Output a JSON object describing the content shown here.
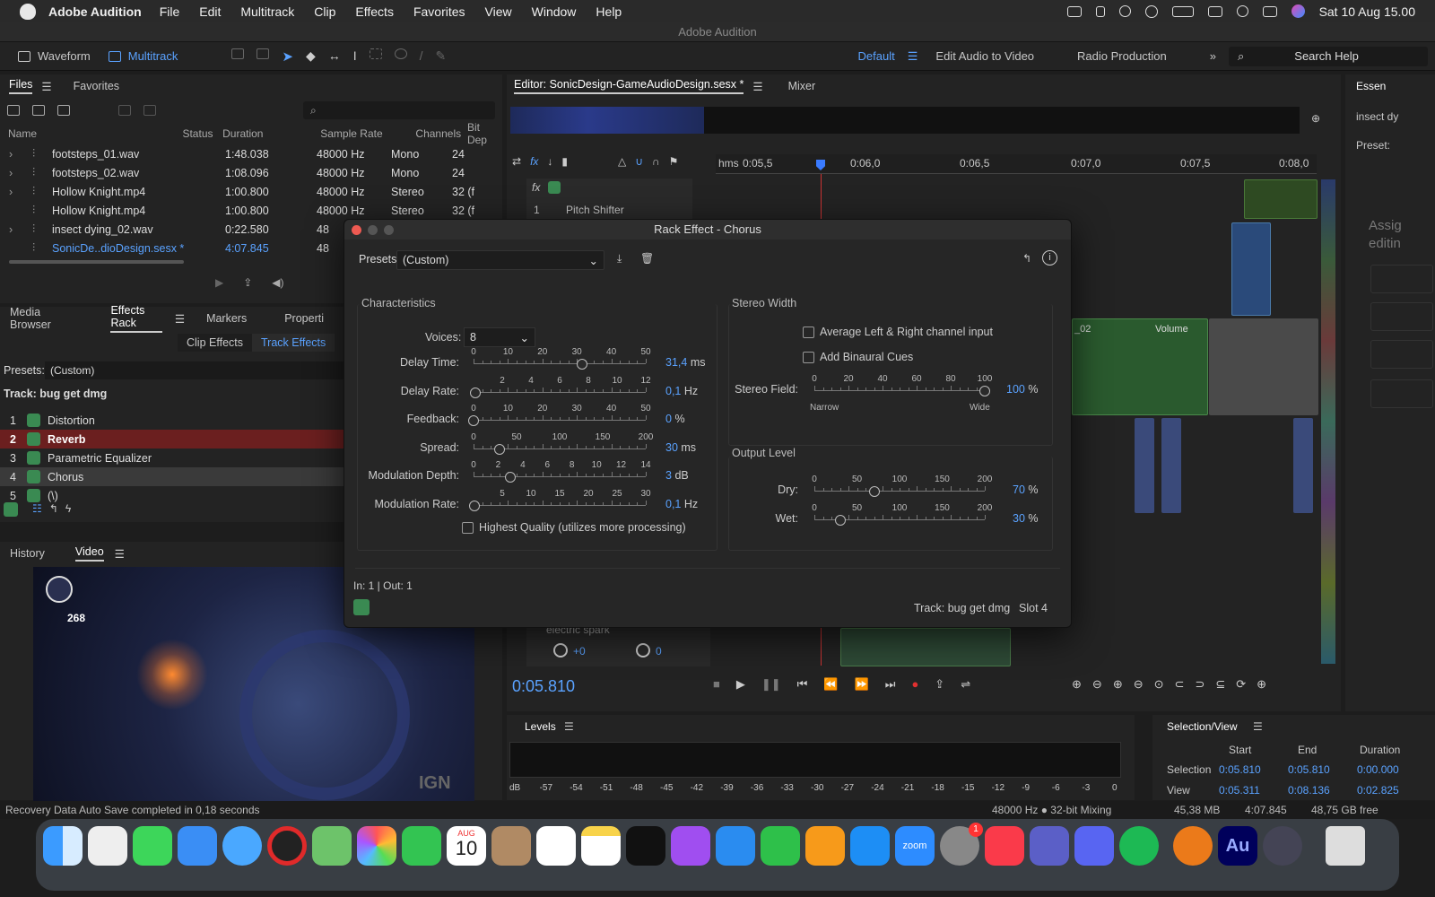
{
  "menubar": {
    "app": "Adobe Audition",
    "items": [
      "File",
      "Edit",
      "Multitrack",
      "Clip",
      "Effects",
      "Favorites",
      "View",
      "Window",
      "Help"
    ],
    "datetime": "Sat 10 Aug  15.00"
  },
  "window_title": "Adobe Audition",
  "toolbar": {
    "waveform": "Waveform",
    "multitrack": "Multitrack",
    "workspaces": [
      "Default",
      "Edit Audio to Video",
      "Radio Production"
    ],
    "search_placeholder": "Search Help"
  },
  "files_panel": {
    "tabs": [
      "Files",
      "Favorites"
    ],
    "columns": [
      "Name",
      "Status",
      "Duration",
      "Sample Rate",
      "Channels",
      "Bit Dep"
    ],
    "rows": [
      {
        "name": "footsteps_01.wav",
        "duration": "1:48.038",
        "rate": "48000 Hz",
        "channels": "Mono",
        "bits": "24"
      },
      {
        "name": "footsteps_02.wav",
        "duration": "1:08.096",
        "rate": "48000 Hz",
        "channels": "Mono",
        "bits": "24"
      },
      {
        "name": "Hollow Knight.mp4",
        "duration": "1:00.800",
        "rate": "48000 Hz",
        "channels": "Stereo",
        "bits": "32 (f"
      },
      {
        "name": "Hollow Knight.mp4",
        "duration": "1:00.800",
        "rate": "48000 Hz",
        "channels": "Stereo",
        "bits": "32 (f"
      },
      {
        "name": "insect dying_02.wav",
        "duration": "0:22.580",
        "rate": "48",
        "channels": "",
        "bits": ""
      },
      {
        "name": "SonicDe..dioDesign.sesx *",
        "duration": "4:07.845",
        "rate": "48",
        "channels": "",
        "bits": ""
      }
    ]
  },
  "effects_panel": {
    "tabs": [
      "Media Browser",
      "Effects Rack",
      "Markers",
      "Properti"
    ],
    "subtabs": [
      "Clip Effects",
      "Track Effects"
    ],
    "presets_label": "Presets:",
    "presets_value": "(Custom)",
    "track_label": "Track: bug get dmg",
    "items": [
      {
        "num": "1",
        "name": "Distortion"
      },
      {
        "num": "2",
        "name": "Reverb"
      },
      {
        "num": "3",
        "name": "Parametric Equalizer"
      },
      {
        "num": "4",
        "name": "Chorus"
      },
      {
        "num": "5",
        "name": "(\\)"
      }
    ]
  },
  "video_panel": {
    "tabs": [
      "History",
      "Video"
    ],
    "hud_count": "268",
    "watermark": "IGN"
  },
  "editor": {
    "tabs": [
      "Editor: SonicDesign-GameAudioDesign.sesx *",
      "Mixer"
    ],
    "ruler_labels": [
      "hms",
      "0:05,5",
      "0:06,0",
      "0:06,5",
      "0:07,0",
      "0:07,5",
      "0:08,0"
    ],
    "track_fx": "Pitch Shifter",
    "track_fx_num": "1",
    "clip_label": "_02",
    "volume_label": "Volume",
    "bottom_track": "electric spark",
    "knob_vol": "+0",
    "knob_pan": "0",
    "time": "0:05.810"
  },
  "right_panel": {
    "tab": "Essen",
    "item": "insect dy",
    "presets": "Preset:",
    "assign": "Assig",
    "editing": "editin"
  },
  "dialog": {
    "title": "Rack Effect - Chorus",
    "presets_label": "Presets:",
    "presets_value": "(Custom)",
    "characteristics": "Characteristics",
    "voices_label": "Voices:",
    "voices_value": "8",
    "sliders": [
      {
        "label": "Delay Time:",
        "ticks": [
          "0",
          "10",
          "20",
          "30",
          "40",
          "50"
        ],
        "min": 0,
        "max": 50,
        "value": 31.4,
        "display": "31,4",
        "unit": "ms"
      },
      {
        "label": "Delay Rate:",
        "ticks": [
          "2",
          "4",
          "6",
          "8",
          "10",
          "12"
        ],
        "min": 0,
        "max": 12,
        "value": 0.1,
        "display": "0,1",
        "unit": "Hz"
      },
      {
        "label": "Feedback:",
        "ticks": [
          "0",
          "10",
          "20",
          "30",
          "40",
          "50"
        ],
        "min": 0,
        "max": 50,
        "value": 0,
        "display": "0",
        "unit": "%"
      },
      {
        "label": "Spread:",
        "ticks": [
          "0",
          "50",
          "100",
          "150",
          "200"
        ],
        "min": 0,
        "max": 200,
        "value": 30,
        "display": "30",
        "unit": "ms"
      },
      {
        "label": "Modulation Depth:",
        "ticks": [
          "0",
          "2",
          "4",
          "6",
          "8",
          "10",
          "12",
          "14"
        ],
        "min": 0,
        "max": 14,
        "value": 3,
        "display": "3",
        "unit": "dB"
      },
      {
        "label": "Modulation Rate:",
        "ticks": [
          "5",
          "10",
          "15",
          "20",
          "25",
          "30"
        ],
        "min": 0,
        "max": 30,
        "value": 0.1,
        "display": "0,1",
        "unit": "Hz"
      }
    ],
    "highest_quality": "Highest Quality (utilizes more processing)",
    "stereo_width": "Stereo Width",
    "avg_lr": "Average Left & Right channel input",
    "binaural": "Add Binaural Cues",
    "stereo_field": {
      "label": "Stereo Field:",
      "ticks": [
        "0",
        "20",
        "40",
        "60",
        "80",
        "100"
      ],
      "min": 0,
      "max": 100,
      "value": 100,
      "display": "100",
      "unit": "%",
      "narrow": "Narrow",
      "wide": "Wide"
    },
    "output_level": "Output Level",
    "dry": {
      "label": "Dry:",
      "ticks": [
        "0",
        "50",
        "100",
        "150",
        "200"
      ],
      "min": 0,
      "max": 200,
      "value": 70,
      "display": "70",
      "unit": "%"
    },
    "wet": {
      "label": "Wet:",
      "ticks": [
        "0",
        "50",
        "100",
        "150",
        "200"
      ],
      "min": 0,
      "max": 200,
      "value": 30,
      "display": "30",
      "unit": "%"
    },
    "io": "In: 1 | Out: 1",
    "track": "Track: bug get dmg",
    "slot": "Slot 4"
  },
  "levels": {
    "title": "Levels",
    "scale": [
      "dB",
      "-57",
      "-54",
      "-51",
      "-48",
      "-45",
      "-42",
      "-39",
      "-36",
      "-33",
      "-30",
      "-27",
      "-24",
      "-21",
      "-18",
      "-15",
      "-12",
      "-9",
      "-6",
      "-3",
      "0"
    ]
  },
  "selection_view": {
    "title": "Selection/View",
    "headers": [
      "Start",
      "End",
      "Duration"
    ],
    "rows": [
      {
        "label": "Selection",
        "start": "0:05.810",
        "end": "0:05.810",
        "duration": "0:00.000"
      },
      {
        "label": "View",
        "start": "0:05.311",
        "end": "0:08.136",
        "duration": "0:02.825"
      }
    ]
  },
  "status": {
    "left": "Recovery Data Auto Save completed in 0,18 seconds",
    "mixing": "48000 Hz ● 32-bit Mixing",
    "memory": "45,38 MB",
    "duration": "4:07.845",
    "free": "48,75 GB free"
  },
  "dock": {
    "calendar_month": "AUG",
    "calendar_day": "10",
    "zoom": "zoom",
    "badge": "1",
    "au": "Au"
  },
  "colors": {
    "accent": "#5aa2ff",
    "power": "#3a8a52",
    "reverb_row": "#6b1f1f",
    "record": "#e03030"
  }
}
